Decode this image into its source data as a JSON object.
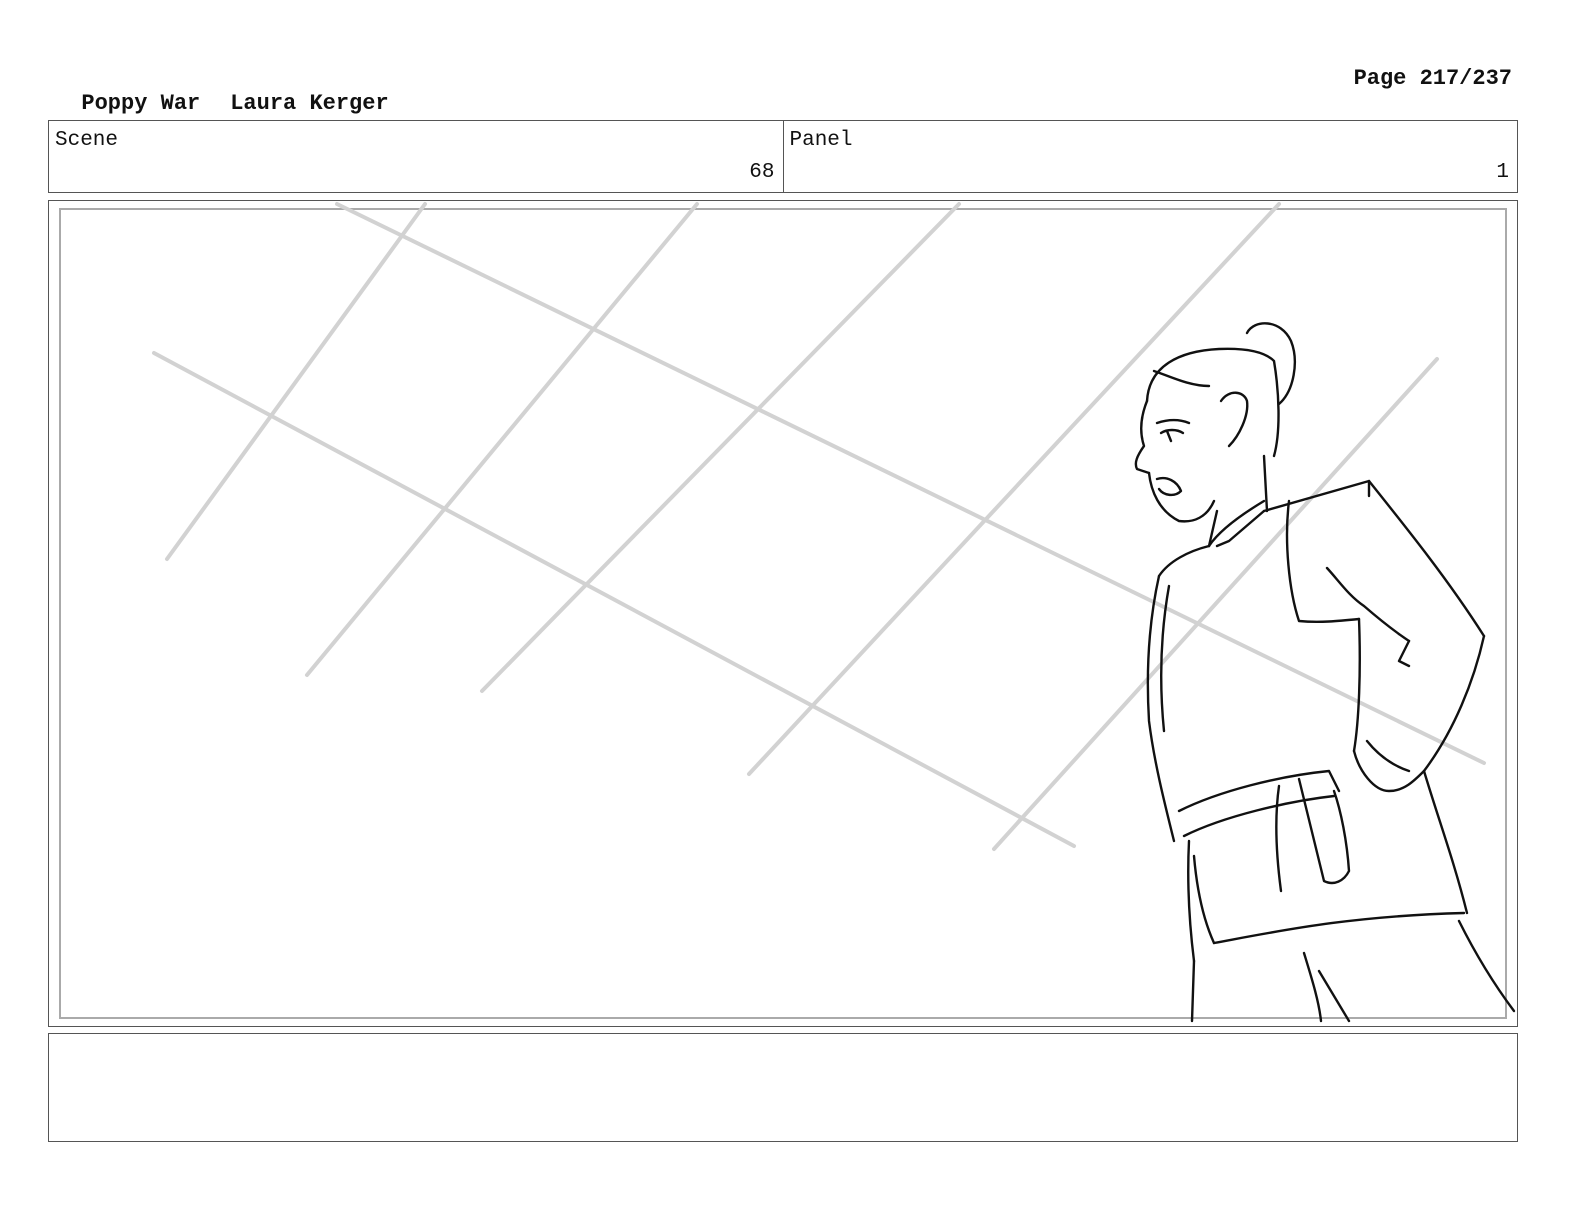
{
  "header": {
    "title": "Poppy War",
    "author": "Laura Kerger",
    "page_label": "Page 217/237"
  },
  "scene": {
    "label": "Scene",
    "value": "68"
  },
  "panel": {
    "label": "Panel",
    "value": "1"
  },
  "notes": {
    "text": ""
  }
}
